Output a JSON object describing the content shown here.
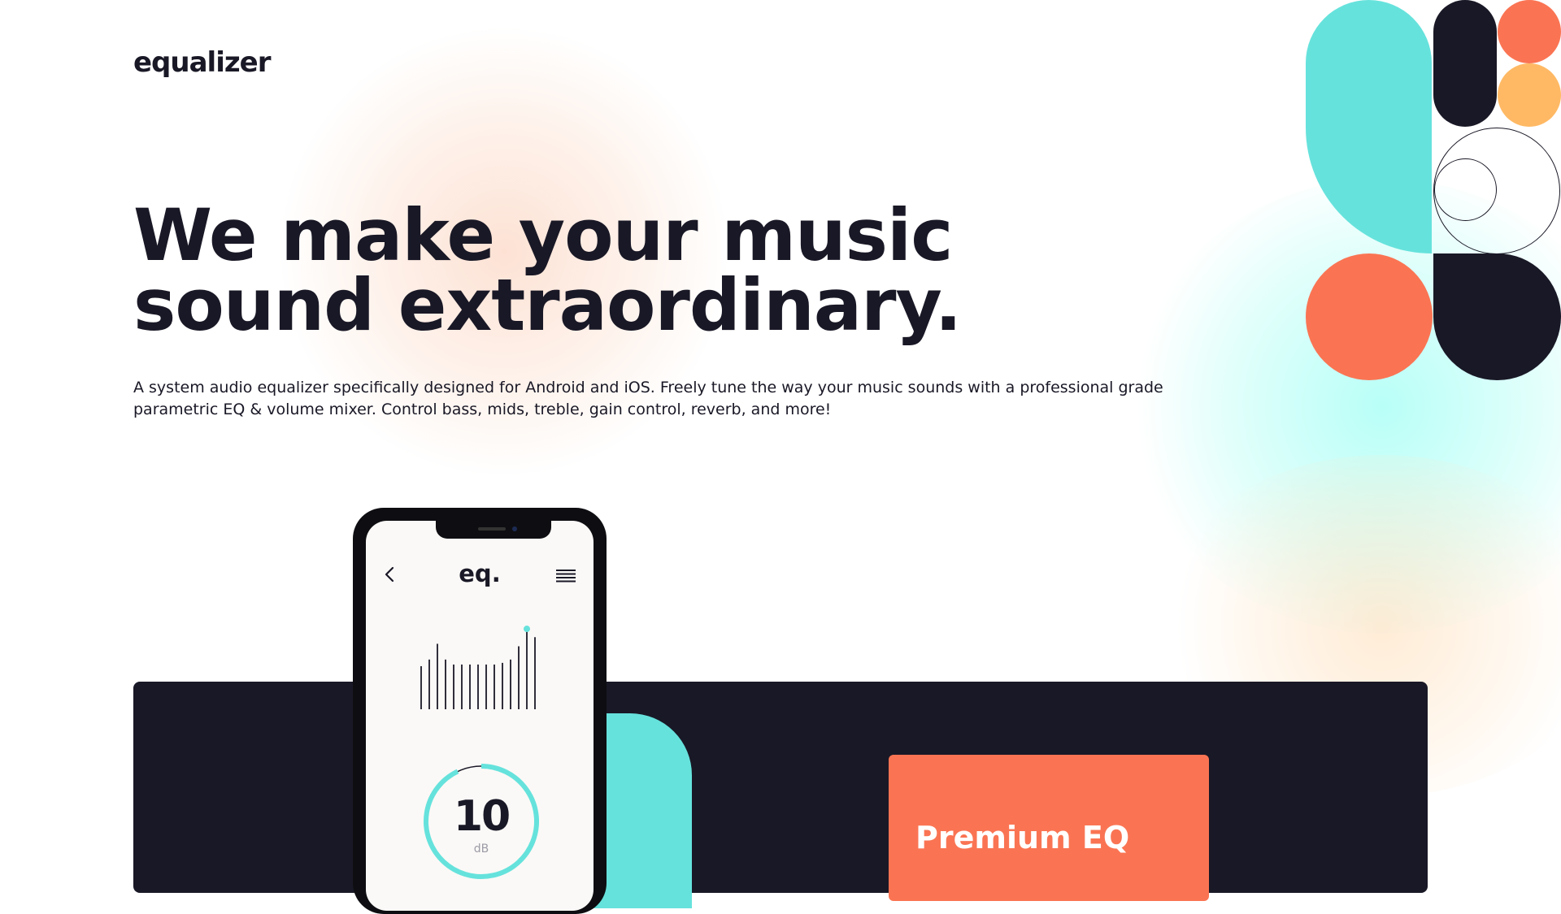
{
  "brand": {
    "logo": "equalizer"
  },
  "hero": {
    "title": "We make your music sound extraordinary.",
    "description": "A system audio equalizer specifically designed for Android and iOS. Freely tune the way your music sounds with a professional grade parametric EQ & volume mixer. Control bass, mids, treble, gain control, reverb, and more!"
  },
  "phone": {
    "app_name": "eq.",
    "db_value": "10",
    "db_unit": "dB",
    "knob_level_fraction": 0.93,
    "back_icon": "chevron-left-icon",
    "menu_icon": "hamburger-menu-icon",
    "eq_levels": [
      0.52,
      0.6,
      0.79,
      0.6,
      0.54,
      0.54,
      0.54,
      0.54,
      0.54,
      0.54,
      0.56,
      0.6,
      0.76,
      0.97,
      0.87
    ]
  },
  "premium": {
    "title": "Premium EQ"
  },
  "colors": {
    "navy": "#191826",
    "cyan": "#66e2dc",
    "orange": "#fa7453",
    "yellow": "#ffb964",
    "white": "#ffffff"
  }
}
